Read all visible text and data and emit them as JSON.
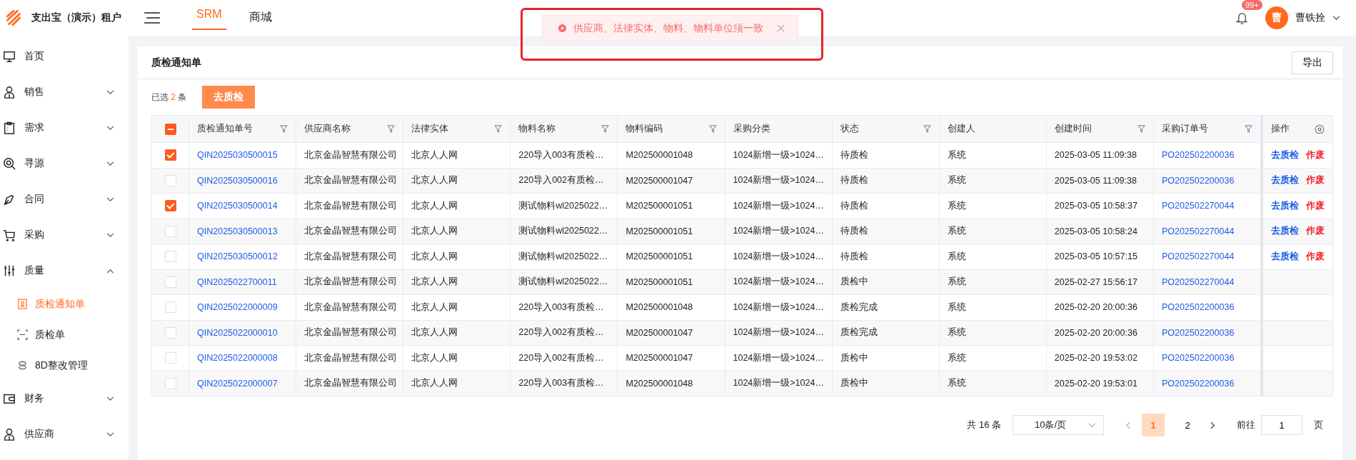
{
  "header": {
    "brand": "支出宝（演示）租户",
    "tabs": [
      {
        "label": "SRM",
        "selected": true
      },
      {
        "label": "商城",
        "selected": false
      }
    ],
    "toast": {
      "message": "供应商、法律实体、物料、物料单位须一致"
    },
    "notifications": {
      "badge": "99+"
    },
    "user": {
      "avatar": "曹",
      "name": "曹铁拴"
    }
  },
  "sidebar": {
    "items": [
      {
        "label": "首页",
        "kind": "link"
      },
      {
        "label": "销售",
        "kind": "group",
        "expanded": false
      },
      {
        "label": "需求",
        "kind": "group",
        "expanded": false
      },
      {
        "label": "寻源",
        "kind": "group",
        "expanded": false
      },
      {
        "label": "合同",
        "kind": "group",
        "expanded": false
      },
      {
        "label": "采购",
        "kind": "group",
        "expanded": false
      },
      {
        "label": "质量",
        "kind": "group",
        "expanded": true,
        "children": [
          {
            "label": "质检通知单",
            "selected": true
          },
          {
            "label": "质检单",
            "selected": false
          },
          {
            "label": "8D整改管理",
            "selected": false
          }
        ]
      },
      {
        "label": "财务",
        "kind": "group",
        "expanded": false
      },
      {
        "label": "供应商",
        "kind": "group",
        "expanded": false
      }
    ]
  },
  "page": {
    "title": "质检通知单",
    "export_button": "导出",
    "selection": {
      "prefix": "已选",
      "count": "2",
      "suffix": "条"
    },
    "bulk_button": "去质检"
  },
  "table": {
    "header_indeterminate": true,
    "columns": [
      {
        "label": "质检通知单号",
        "filter": true,
        "kind": "link"
      },
      {
        "label": "供应商名称",
        "filter": true,
        "kind": "text"
      },
      {
        "label": "法律实体",
        "filter": true,
        "kind": "text"
      },
      {
        "label": "物料名称",
        "filter": true,
        "kind": "text"
      },
      {
        "label": "物料编码",
        "filter": true,
        "kind": "text"
      },
      {
        "label": "采购分类",
        "filter": false,
        "kind": "text"
      },
      {
        "label": "状态",
        "filter": true,
        "kind": "text"
      },
      {
        "label": "创建人",
        "filter": false,
        "kind": "text"
      },
      {
        "label": "创建时间",
        "filter": true,
        "kind": "text"
      },
      {
        "label": "采购订单号",
        "filter": true,
        "kind": "link"
      }
    ],
    "actions_label": "操作",
    "rows": [
      {
        "selected": true,
        "cells": [
          "QIN2025030500015",
          "北京金晶智慧有限公司",
          "北京人人网",
          "220导入003有质检…",
          "M202500001048",
          "1024新增一级>1024…",
          "待质检",
          "系统",
          "2025-03-05 11:09:38",
          "PO202502200036"
        ],
        "actions": [
          {
            "label": "去质检",
            "kind": "primary"
          },
          {
            "label": "作废",
            "kind": "danger"
          }
        ]
      },
      {
        "selected": false,
        "cells": [
          "QIN2025030500016",
          "北京金晶智慧有限公司",
          "北京人人网",
          "220导入002有质检…",
          "M202500001047",
          "1024新增一级>1024…",
          "待质检",
          "系统",
          "2025-03-05 11:09:38",
          "PO202502200036"
        ],
        "actions": [
          {
            "label": "去质检",
            "kind": "primary"
          },
          {
            "label": "作废",
            "kind": "danger"
          }
        ]
      },
      {
        "selected": true,
        "cells": [
          "QIN2025030500014",
          "北京金晶智慧有限公司",
          "北京人人网",
          "测试物料wl2025022…",
          "M202500001051",
          "1024新增一级>1024…",
          "待质检",
          "系统",
          "2025-03-05 10:58:37",
          "PO202502270044"
        ],
        "actions": [
          {
            "label": "去质检",
            "kind": "primary"
          },
          {
            "label": "作废",
            "kind": "danger"
          }
        ]
      },
      {
        "selected": false,
        "cells": [
          "QIN2025030500013",
          "北京金晶智慧有限公司",
          "北京人人网",
          "测试物料wl2025022…",
          "M202500001051",
          "1024新增一级>1024…",
          "待质检",
          "系统",
          "2025-03-05 10:58:24",
          "PO202502270044"
        ],
        "actions": [
          {
            "label": "去质检",
            "kind": "primary"
          },
          {
            "label": "作废",
            "kind": "danger"
          }
        ]
      },
      {
        "selected": false,
        "cells": [
          "QIN2025030500012",
          "北京金晶智慧有限公司",
          "北京人人网",
          "测试物料wl2025022…",
          "M202500001051",
          "1024新增一级>1024…",
          "待质检",
          "系统",
          "2025-03-05 10:57:15",
          "PO202502270044"
        ],
        "actions": [
          {
            "label": "去质检",
            "kind": "primary"
          },
          {
            "label": "作废",
            "kind": "danger"
          }
        ]
      },
      {
        "selected": false,
        "cells": [
          "QIN2025022700011",
          "北京金晶智慧有限公司",
          "北京人人网",
          "测试物料wl2025022…",
          "M202500001051",
          "1024新增一级>1024…",
          "质检中",
          "系统",
          "2025-02-27 15:56:17",
          "PO202502270044"
        ],
        "actions": []
      },
      {
        "selected": false,
        "cells": [
          "QIN2025022000009",
          "北京金晶智慧有限公司",
          "北京人人网",
          "220导入003有质检…",
          "M202500001048",
          "1024新增一级>1024…",
          "质检完成",
          "系统",
          "2025-02-20 20:00:36",
          "PO202502200036"
        ],
        "actions": []
      },
      {
        "selected": false,
        "cells": [
          "QIN2025022000010",
          "北京金晶智慧有限公司",
          "北京人人网",
          "220导入002有质检…",
          "M202500001047",
          "1024新增一级>1024…",
          "质检完成",
          "系统",
          "2025-02-20 20:00:36",
          "PO202502200036"
        ],
        "actions": []
      },
      {
        "selected": false,
        "cells": [
          "QIN2025022000008",
          "北京金晶智慧有限公司",
          "北京人人网",
          "220导入002有质检…",
          "M202500001047",
          "1024新增一级>1024…",
          "质检中",
          "系统",
          "2025-02-20 19:53:02",
          "PO202502200036"
        ],
        "actions": []
      },
      {
        "selected": false,
        "cells": [
          "QIN2025022000007",
          "北京金晶智慧有限公司",
          "北京人人网",
          "220导入003有质检…",
          "M202500001048",
          "1024新增一级>1024…",
          "质检中",
          "系统",
          "2025-02-20 19:53:01",
          "PO202502200036"
        ],
        "actions": []
      }
    ]
  },
  "pagination": {
    "total": "共 16 条",
    "page_size": "10条/页",
    "pages": [
      {
        "label": "1",
        "selected": true
      },
      {
        "label": "2",
        "selected": false
      }
    ],
    "goto_label": "前往",
    "goto_value": "1",
    "goto_suffix": "页"
  }
}
